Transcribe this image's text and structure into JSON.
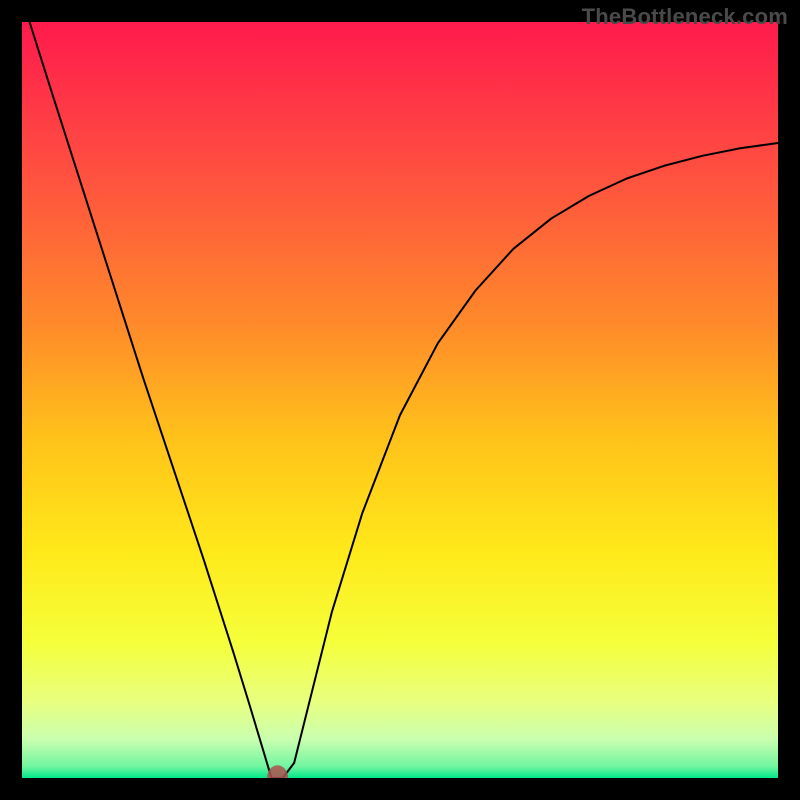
{
  "watermark": "TheBottleneck.com",
  "chart_data": {
    "type": "line",
    "title": "",
    "xlabel": "",
    "ylabel": "",
    "xlim": [
      0,
      100
    ],
    "ylim": [
      0,
      100
    ],
    "background_gradient": {
      "stops": [
        {
          "offset": 0.0,
          "color": "#ff1a4d"
        },
        {
          "offset": 0.2,
          "color": "#ff5040"
        },
        {
          "offset": 0.4,
          "color": "#ff8a2a"
        },
        {
          "offset": 0.55,
          "color": "#ffc21a"
        },
        {
          "offset": 0.7,
          "color": "#ffe91a"
        },
        {
          "offset": 0.82,
          "color": "#f5ff3a"
        },
        {
          "offset": 0.9,
          "color": "#e8ff80"
        },
        {
          "offset": 0.95,
          "color": "#c8ffb0"
        },
        {
          "offset": 0.985,
          "color": "#70f5a0"
        },
        {
          "offset": 1.0,
          "color": "#00e88a"
        }
      ]
    },
    "marker": {
      "x": 33.8,
      "y": 0.0,
      "r": 1.4,
      "color": "#b05050"
    },
    "series": [
      {
        "name": "bottleneck-curve",
        "color": "#000000",
        "width": 2,
        "x": [
          1.0,
          4.0,
          8.0,
          12.0,
          16.0,
          20.0,
          24.0,
          28.0,
          30.0,
          31.5,
          33.0,
          34.5,
          36.0,
          38.0,
          41.0,
          45.0,
          50.0,
          55.0,
          60.0,
          65.0,
          70.0,
          75.0,
          80.0,
          85.0,
          90.0,
          95.0,
          100.0
        ],
        "values": [
          100.0,
          90.5,
          78.0,
          65.5,
          53.0,
          41.0,
          29.0,
          16.5,
          10.0,
          5.0,
          0.0,
          0.0,
          2.0,
          10.0,
          22.0,
          35.0,
          48.0,
          57.5,
          64.5,
          70.0,
          74.0,
          77.0,
          79.3,
          81.0,
          82.3,
          83.3,
          84.0
        ]
      }
    ]
  }
}
